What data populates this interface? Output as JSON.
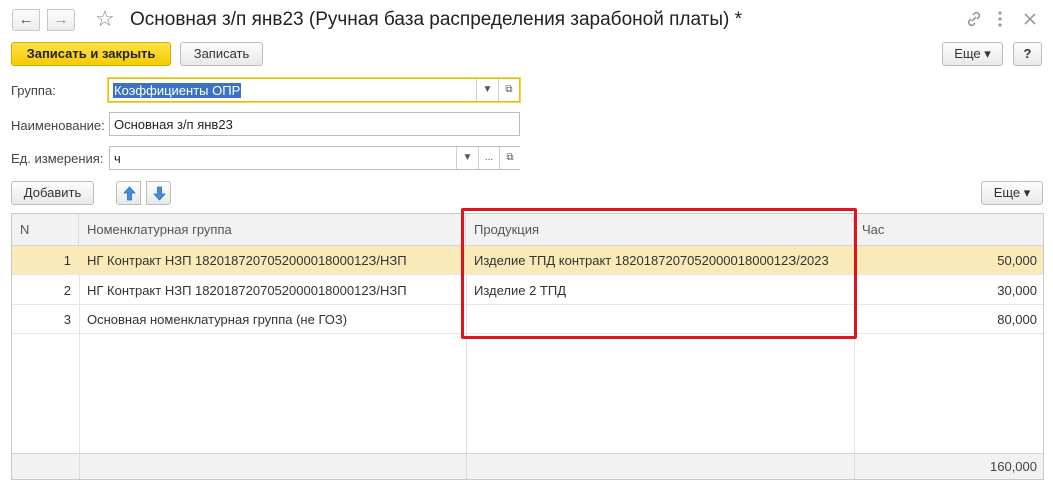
{
  "window": {
    "title": "Основная з/п янв23 (Ручная база распределения зарабоной платы) *",
    "back_glyph": "←",
    "forward_glyph": "→",
    "favorite_icon": "star-icon",
    "link_icon": "link-icon",
    "menu_icon": "kebab-menu-icon",
    "close_icon": "close-icon"
  },
  "toolbar": {
    "save_close_label": "Записать и закрыть",
    "save_label": "Записать",
    "more_label": "Еще ▾",
    "help_label": "?"
  },
  "form": {
    "group_label": "Группа:",
    "group_value": "Коэффициенты ОПР",
    "name_label": "Наименование:",
    "name_value": "Основная з/п янв23",
    "unit_label": "Ед. измерения:",
    "unit_value": "ч"
  },
  "table_toolbar": {
    "add_label": "Добавить",
    "more_label": "Еще ▾"
  },
  "table": {
    "columns": [
      "N",
      "Номенклатурная группа",
      "Продукция",
      "Час"
    ],
    "rows": [
      {
        "n": "1",
        "group": "НГ Контракт НЗП 182018720705200001800012З/НЗП",
        "product": "Изделие ТПД контракт 182018720705200001800012З/2023",
        "hours": "50,000",
        "selected": true
      },
      {
        "n": "2",
        "group": "НГ Контракт НЗП 182018720705200001800012З/НЗП",
        "product": "Изделие 2 ТПД",
        "hours": "30,000",
        "selected": false
      },
      {
        "n": "3",
        "group": "Основная номенклатурная группа (не ГОЗ)",
        "product": "",
        "hours": "80,000",
        "selected": false
      }
    ],
    "total_hours": "160,000"
  },
  "colors": {
    "primary_button": "#f7cb00",
    "selected_row": "#fbeab9",
    "highlight_box": "#e0141e"
  }
}
